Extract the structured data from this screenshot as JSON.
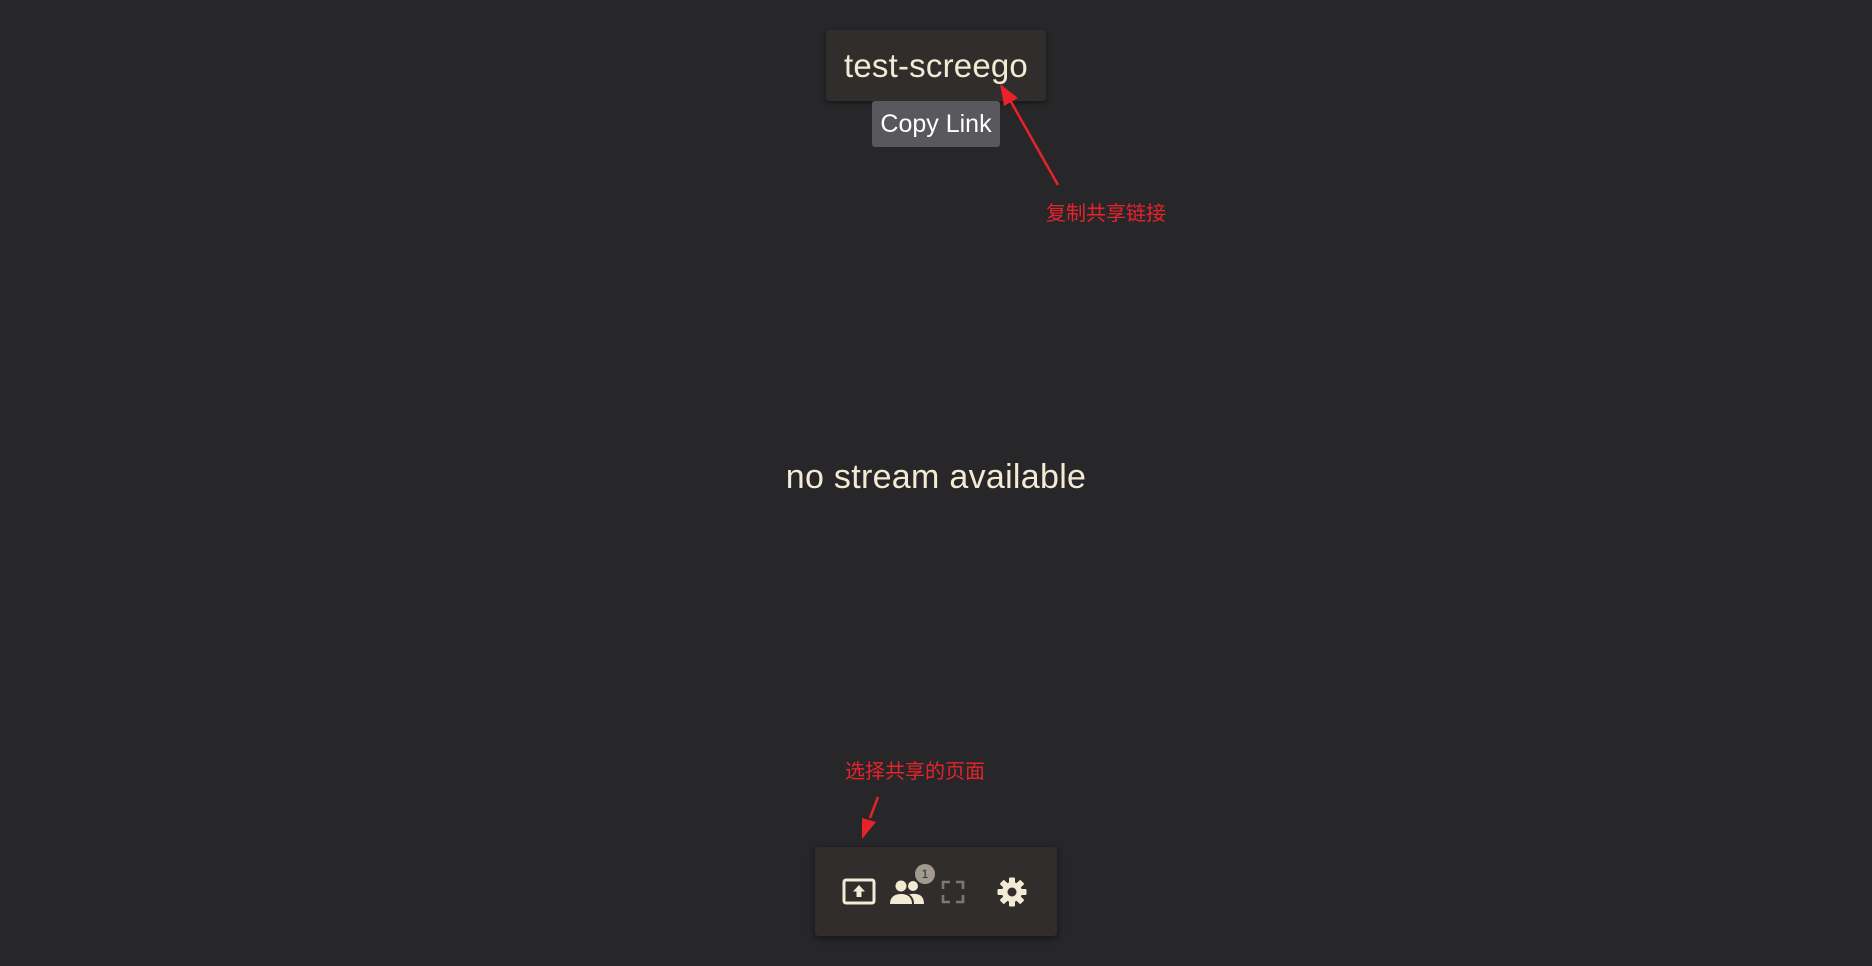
{
  "room": {
    "name": "test-screego",
    "copy_link_label": "Copy Link"
  },
  "main": {
    "status_text": "no stream available"
  },
  "annotations": {
    "copy_link_note": "复制共享链接",
    "select_page_note": "选择共享的页面"
  },
  "toolbar": {
    "buttons": [
      {
        "icon": "screen-share-icon"
      },
      {
        "icon": "people-icon",
        "badge": "1"
      },
      {
        "icon": "fullscreen-icon"
      },
      {
        "icon": "settings-gear-icon"
      }
    ]
  },
  "colors": {
    "background": "#27272a",
    "panel": "#302d2c",
    "text": "#f3ead3",
    "copy_button": "#59585c",
    "annotation": "#e8222a",
    "badge": "#a29a8c"
  }
}
